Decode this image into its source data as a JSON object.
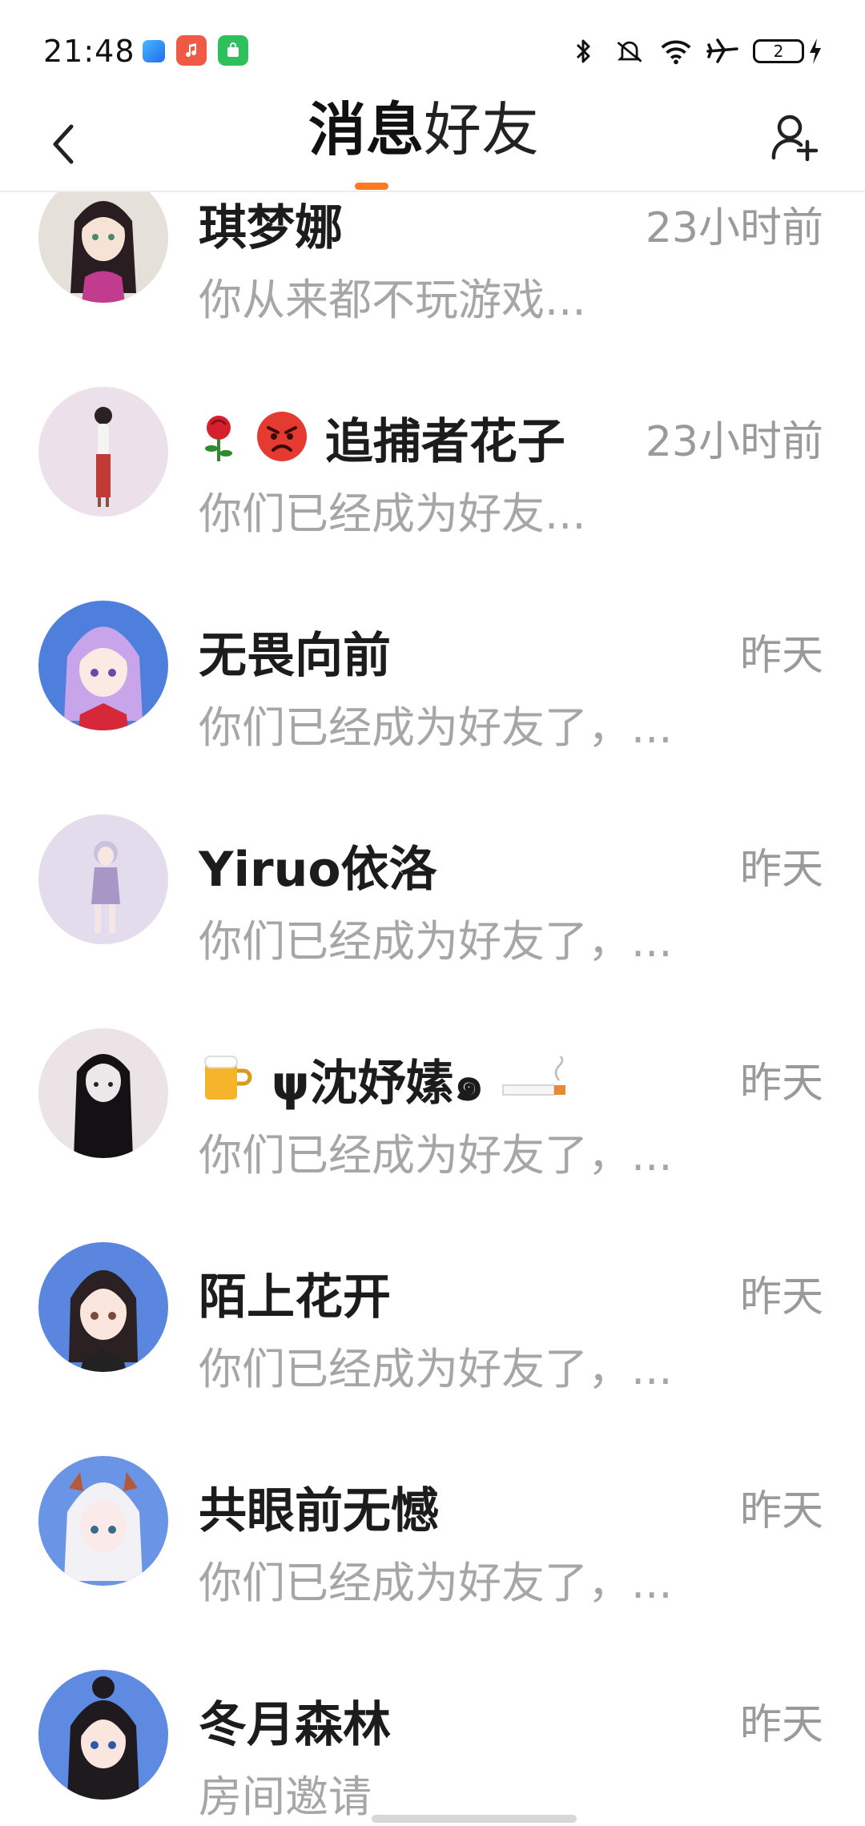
{
  "status_bar": {
    "time": "21:48",
    "battery_level": "2",
    "icons": [
      "bluetooth-icon",
      "mute-icon",
      "wifi-icon",
      "airplane-icon",
      "battery-icon",
      "charging-icon"
    ]
  },
  "header": {
    "back_icon": "chevron-left-icon",
    "tabs": [
      {
        "label": "消息",
        "active": true
      },
      {
        "label": "好友",
        "active": false
      }
    ],
    "add_friend_icon": "add-user-icon",
    "accent_color": "#ff7a22"
  },
  "conversations": [
    {
      "name": "琪梦娜",
      "time": "23小时前",
      "preview": "你从来都不玩游戏..."
    },
    {
      "name": "追捕者花子",
      "time": "23小时前",
      "preview": "你们已经成为好友..."
    },
    {
      "name": "无畏向前",
      "time": "昨天",
      "preview": "你们已经成为好友了，..."
    },
    {
      "name": "Yiruo依洛",
      "time": "昨天",
      "preview": "你们已经成为好友了，..."
    },
    {
      "name": "ψ沈妤嫊๑",
      "time": "昨天",
      "preview": "你们已经成为好友了，..."
    },
    {
      "name": "陌上花开",
      "time": "昨天",
      "preview": "你们已经成为好友了，..."
    },
    {
      "name": "共眼前无憾",
      "time": "昨天",
      "preview": "你们已经成为好友了，..."
    },
    {
      "name": "冬月森林",
      "time": "昨天",
      "preview": "房间邀请"
    }
  ]
}
